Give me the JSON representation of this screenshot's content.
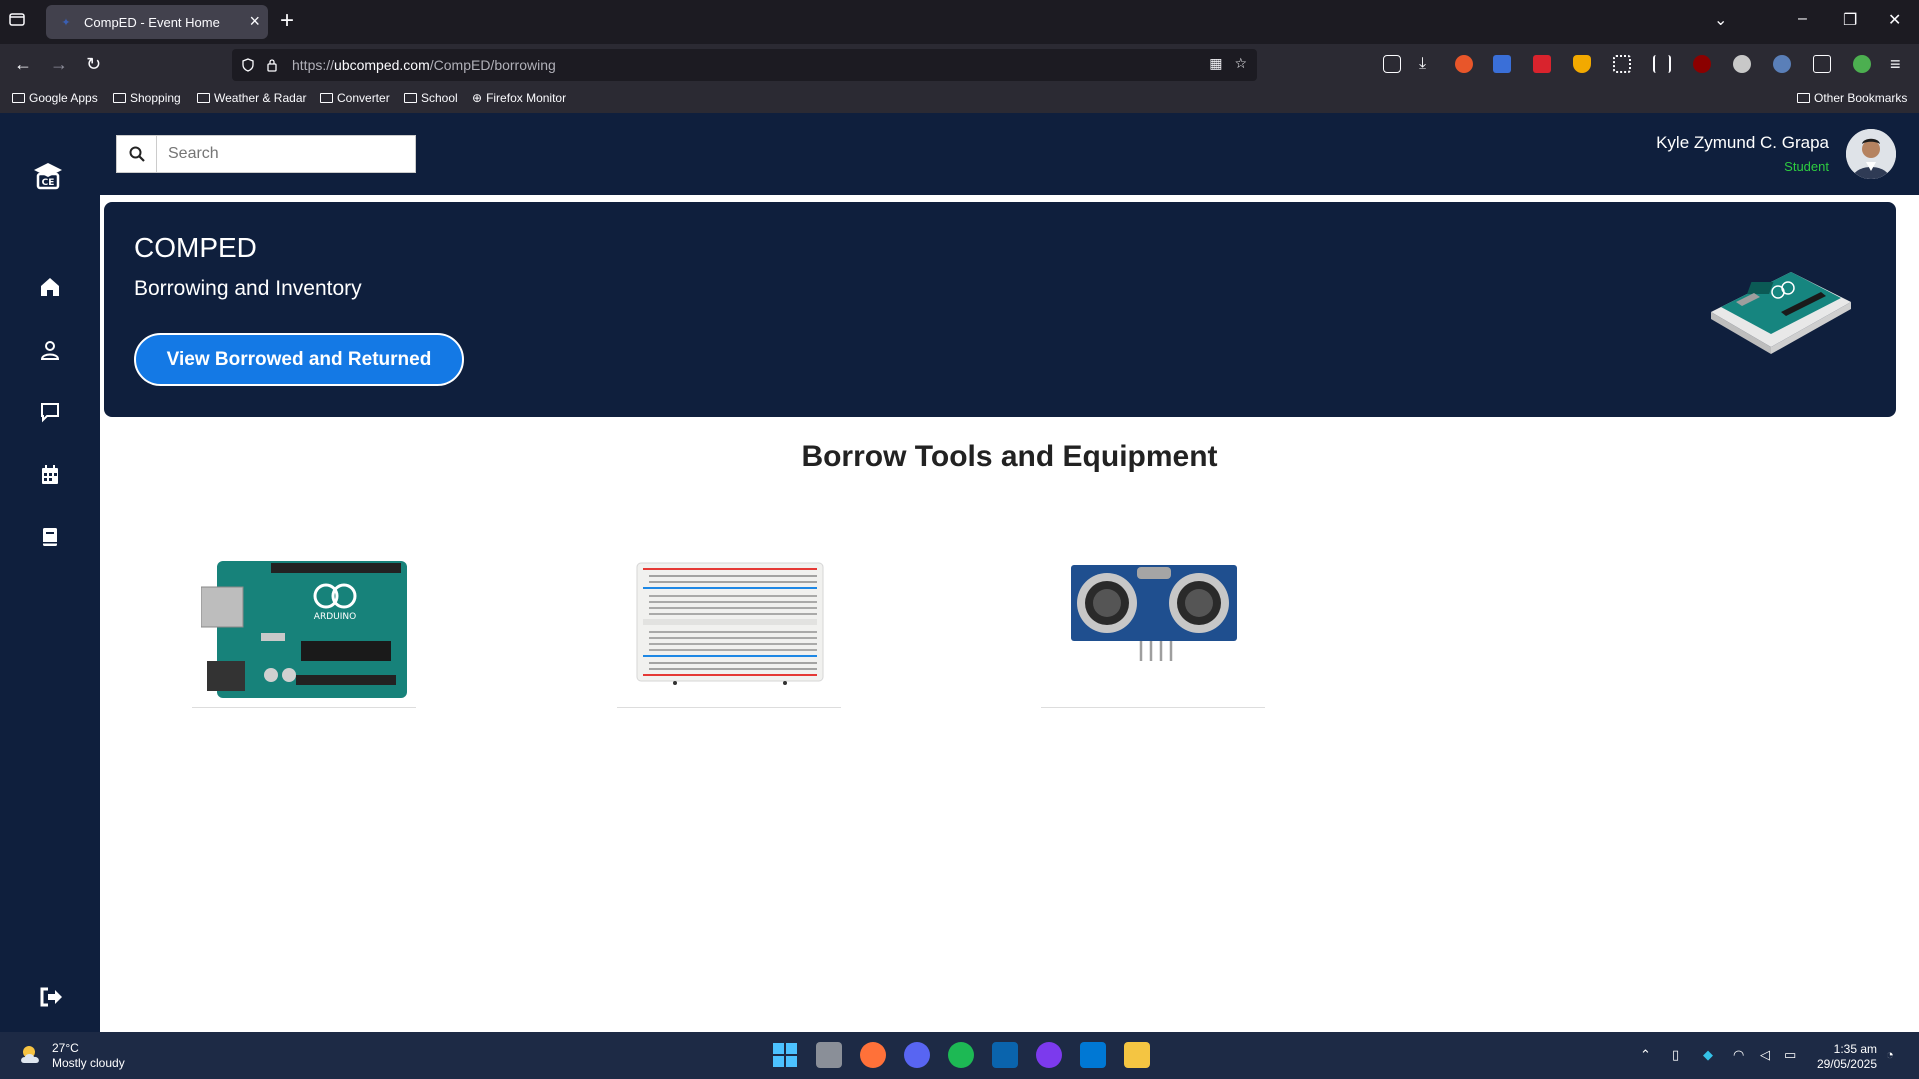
{
  "browser": {
    "tab_title": "CompED - Event Home",
    "url_prefix": "https://",
    "url_domain": "ubcomped.com",
    "url_path": "/CompED/borrowing",
    "bookmarks": [
      "Google Apps",
      "Shopping",
      "Weather & Radar",
      "Converter",
      "School",
      "Firefox Monitor"
    ],
    "other_bookmarks": "Other Bookmarks"
  },
  "header": {
    "search_placeholder": "Search",
    "user_name": "Kyle Zymund C. Grapa",
    "user_role": "Student"
  },
  "banner": {
    "title": "COMPED",
    "subtitle": "Borrowing and Inventory",
    "button_label": "View Borrowed and Returned"
  },
  "main": {
    "section_title": "Borrow Tools and Equipment"
  },
  "taskbar": {
    "temperature": "27°C",
    "weather": "Mostly cloudy",
    "time": "1:35 am",
    "date": "29/05/2025"
  },
  "colors": {
    "sidebar_bg": "#0f1f3d",
    "accent_button": "#1479e5",
    "role_green": "#2ecc40"
  }
}
